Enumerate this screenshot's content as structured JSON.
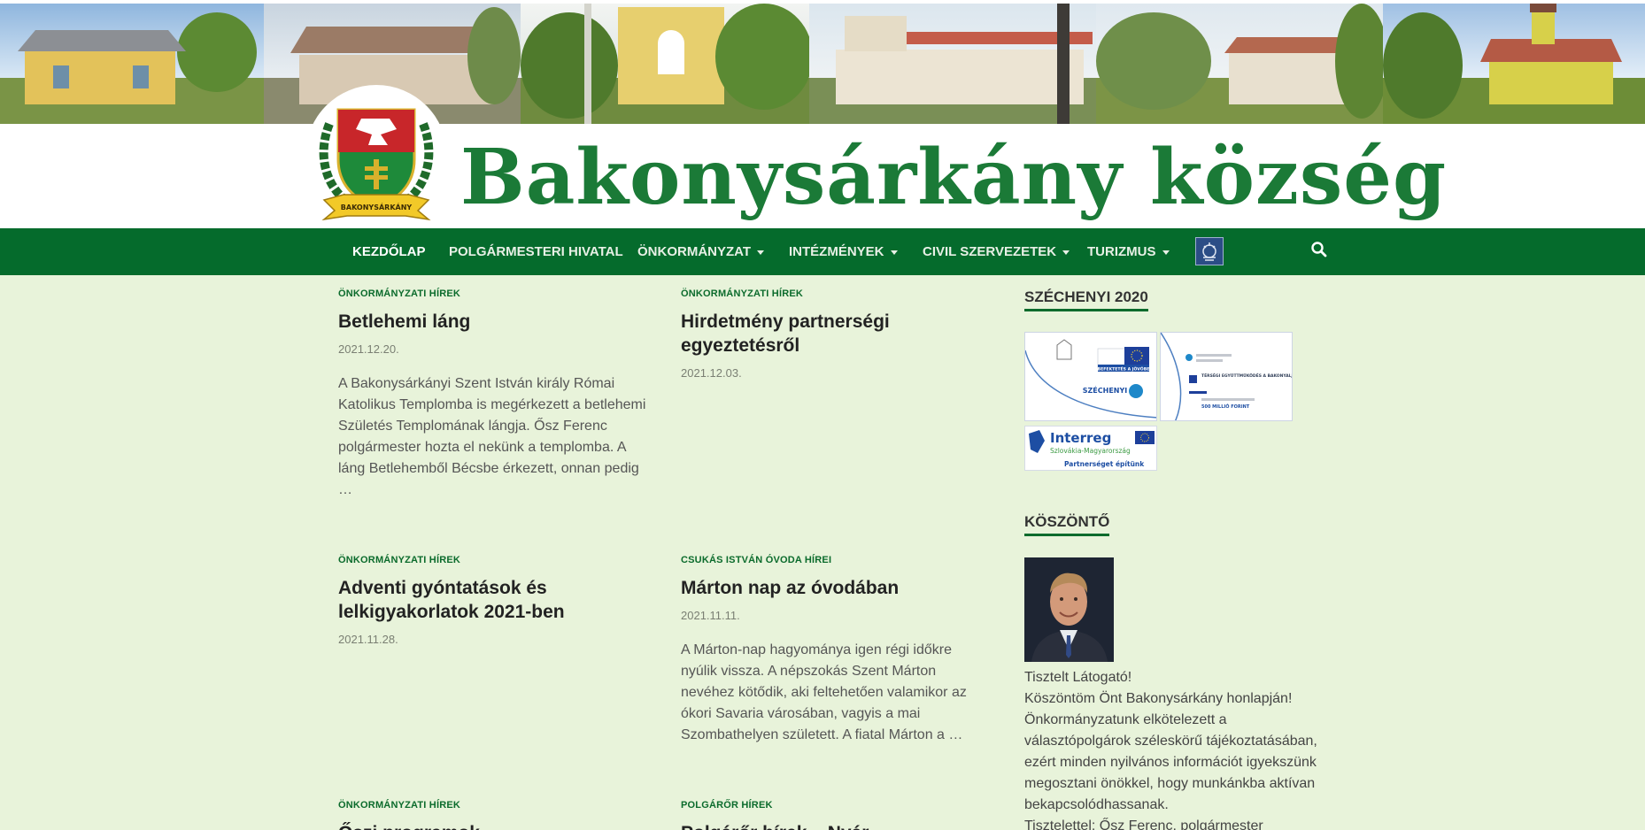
{
  "header": {
    "site_title": "Bakonysárkány község",
    "crest_label": "BAKONYSÁRKÁNY"
  },
  "nav": {
    "items": [
      {
        "label": "KEZDŐLAP",
        "active": true,
        "has_dropdown": false
      },
      {
        "label": "POLGÁRMESTERI HIVATAL",
        "active": false,
        "has_dropdown": false
      },
      {
        "label": "ÖNKORMÁNYZAT",
        "active": false,
        "has_dropdown": true
      },
      {
        "label": "INTÉZMÉNYEK",
        "active": false,
        "has_dropdown": true
      },
      {
        "label": "CIVIL SZERVEZETEK",
        "active": false,
        "has_dropdown": true
      },
      {
        "label": "TURIZMUS",
        "active": false,
        "has_dropdown": true
      }
    ],
    "search_icon": "search-icon"
  },
  "posts": [
    {
      "category": "ÖNKORMÁNYZATI HÍREK",
      "title": "Betlehemi láng",
      "date": "2021.12.20.",
      "excerpt": [
        "A Bakonysárkányi Szent István király Római",
        "Katolikus Templomba is megérkezett a betlehemi",
        "Születés Templomának lángja. Ősz Ferenc",
        "polgármester hozta el nekünk a templomba. A",
        "láng Betlehemből Bécsbe érkezett, onnan pedig",
        "…"
      ]
    },
    {
      "category": "ÖNKORMÁNYZATI HÍREK",
      "title": "Hirdetmény partnerségi egyeztetésről",
      "date": "2021.12.03.",
      "excerpt": []
    },
    {
      "category": "ÖNKORMÁNYZATI HÍREK",
      "title": "Adventi gyóntatások és lelkigyakorlatok 2021-ben",
      "date": "2021.11.28.",
      "excerpt": []
    },
    {
      "category": "CSUKÁS ISTVÁN ÓVODA HÍREI",
      "title": "Márton nap az óvodában",
      "date": "2021.11.11.",
      "excerpt": [
        "A Márton-nap hagyománya igen régi időkre",
        "nyúlik vissza. A népszokás Szent Márton",
        "nevéhez kötődik, aki feltehetően valamikor az",
        "ókori Savaria városában, vagyis a mai",
        "Szombathelyen született. A fiatal Márton a …"
      ]
    },
    {
      "category": "ÖNKORMÁNYZATI HÍREK",
      "title": "Őszi programok",
      "date": "",
      "excerpt": []
    },
    {
      "category": "POLGÁRŐR HÍREK",
      "title": "Polgárőr hírek – Nyár",
      "date": "",
      "excerpt": []
    }
  ],
  "sidebar": {
    "szechenyi": {
      "title": "SZÉCHENYI 2020",
      "card1": {
        "text1": "SZÉCHENYI",
        "text2": "BEFEKTETÉS A JÖVŐBE",
        "text3": "Európai Unió Európai Regionális Fejlesztési Alap"
      },
      "card2": {
        "text1": "TÉRSÉGI EGYÜTTMŰKÖDÉS A BAKONYALJÁTÓL A DUNÁIG",
        "text2": "500 MILLIÓ FORINT"
      },
      "interreg": {
        "brand": "Interreg",
        "region": "Szlovákia-Magyarország",
        "slogan": "Partnerséget építünk"
      }
    },
    "welcome": {
      "title": "KÖSZÖNTŐ",
      "lines": [
        "Tisztelt Látogató!",
        "Köszöntöm Önt Bakonysárkány honlapján!",
        "Önkormányzatunk elkötelezett a",
        "választópolgárok széleskörű tájékoztatásában,",
        "ezért minden nyilvános információt igyekszünk",
        "megosztani önökkel, hogy munkánkba aktívan",
        "bekapcsolódhassanak.",
        "Tisztelettel: Ősz Ferenc, polgármester"
      ]
    }
  },
  "colors": {
    "brand_green": "#056b2c",
    "title_green": "#1b7a37",
    "page_background": "#e8f3da",
    "category_green": "#0b6b2c"
  }
}
